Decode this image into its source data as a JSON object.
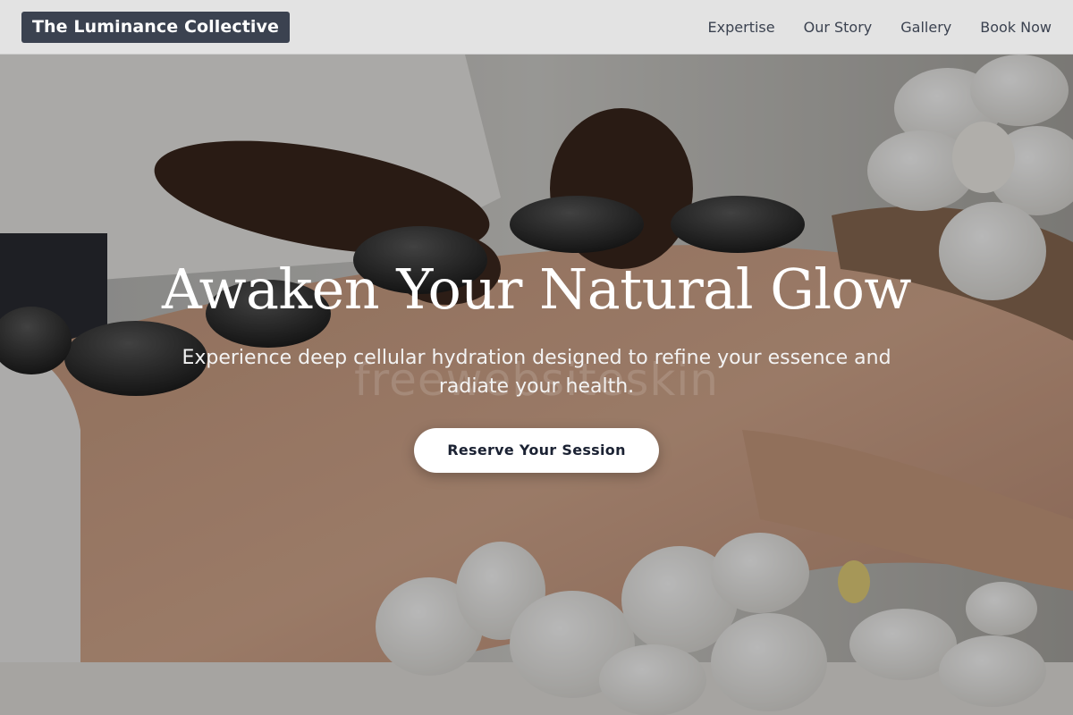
{
  "header": {
    "brand": "The Luminance Collective",
    "nav": [
      {
        "label": "Expertise"
      },
      {
        "label": "Our Story"
      },
      {
        "label": "Gallery"
      },
      {
        "label": "Book Now"
      }
    ]
  },
  "hero": {
    "title": "Awaken Your Natural Glow",
    "subtitle": "Experience deep cellular hydration designed to refine your essence and radiate your health.",
    "cta_label": "Reserve Your Session",
    "watermark": "freewebsiteskin",
    "image_subject": "hot-stone massage with white orchids"
  },
  "colors": {
    "header_bg": "#e3e3e3",
    "brand_bg": "#3b4250",
    "nav_text": "#3b4250",
    "cta_bg": "#ffffff",
    "cta_text": "#1b2233",
    "title_text": "#ffffff"
  }
}
